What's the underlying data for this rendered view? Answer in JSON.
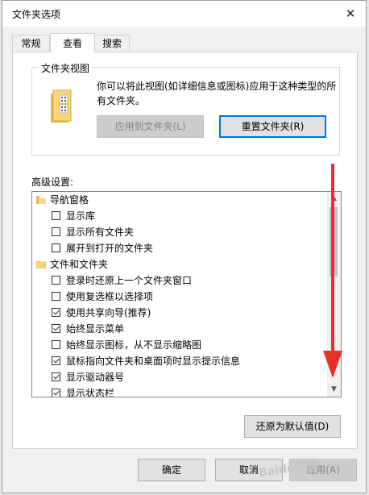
{
  "window": {
    "title": "文件夹选项",
    "close_symbol": "✕"
  },
  "tabs": [
    {
      "label": "常规"
    },
    {
      "label": "查看"
    },
    {
      "label": "搜索"
    }
  ],
  "folder_views": {
    "legend": "文件夹视图",
    "description": "你可以将此视图(如详细信息或图标)应用于这种类型的所有文件夹。",
    "apply_button": "应用到文件夹(L)",
    "reset_button": "重置文件夹(R)"
  },
  "advanced": {
    "label": "高级设置:",
    "items": [
      {
        "label": "导航窗格",
        "type": "category",
        "icon": "navigation-pane-icon"
      },
      {
        "label": "显示库",
        "type": "checkbox",
        "checked": false
      },
      {
        "label": "显示所有文件夹",
        "type": "checkbox",
        "checked": false
      },
      {
        "label": "展开到打开的文件夹",
        "type": "checkbox",
        "checked": false
      },
      {
        "label": "文件和文件夹",
        "type": "category",
        "icon": "folder-icon"
      },
      {
        "label": "登录时还原上一个文件夹窗口",
        "type": "checkbox",
        "checked": false
      },
      {
        "label": "使用复选框以选择项",
        "type": "checkbox",
        "checked": false
      },
      {
        "label": "使用共享向导(推荐)",
        "type": "checkbox",
        "checked": true
      },
      {
        "label": "始终显示菜单",
        "type": "checkbox",
        "checked": true
      },
      {
        "label": "始终显示图标，从不显示缩略图",
        "type": "checkbox",
        "checked": false
      },
      {
        "label": "鼠标指向文件夹和桌面项时显示提示信息",
        "type": "checkbox",
        "checked": true
      },
      {
        "label": "显示驱动器号",
        "type": "checkbox",
        "checked": true
      },
      {
        "label": "显示状态栏",
        "type": "checkbox",
        "checked": true
      }
    ],
    "restore_button": "还原为默认值(D)"
  },
  "footer": {
    "ok": "确定",
    "cancel": "取消",
    "apply": "应用(A)"
  },
  "watermark": "Baidu经验",
  "colors": {
    "accent": "#0078d7",
    "annotation_arrow": "#e8302a"
  }
}
